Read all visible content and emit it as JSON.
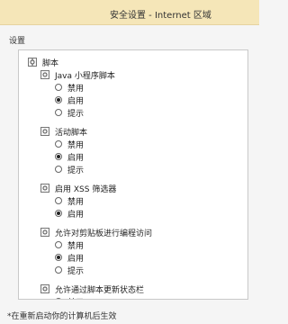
{
  "window": {
    "title": "安全设置 - Internet 区域"
  },
  "group": {
    "label": "设置"
  },
  "tree": {
    "root": "脚本",
    "sections": [
      {
        "label": "Java 小程序脚本",
        "options": [
          "禁用",
          "启用",
          "提示"
        ],
        "selected": 1
      },
      {
        "label": "活动脚本",
        "options": [
          "禁用",
          "启用",
          "提示"
        ],
        "selected": 1
      },
      {
        "label": "启用 XSS 筛选器",
        "options": [
          "禁用",
          "启用"
        ],
        "selected": 1
      },
      {
        "label": "允许对剪贴板进行编程访问",
        "options": [
          "禁用",
          "启用",
          "提示"
        ],
        "selected": 1
      },
      {
        "label": "允许通过脚本更新状态栏",
        "options": [
          "禁用"
        ],
        "selected": -1
      }
    ]
  },
  "footer": {
    "note": "*在重新启动你的计算机后生效"
  }
}
